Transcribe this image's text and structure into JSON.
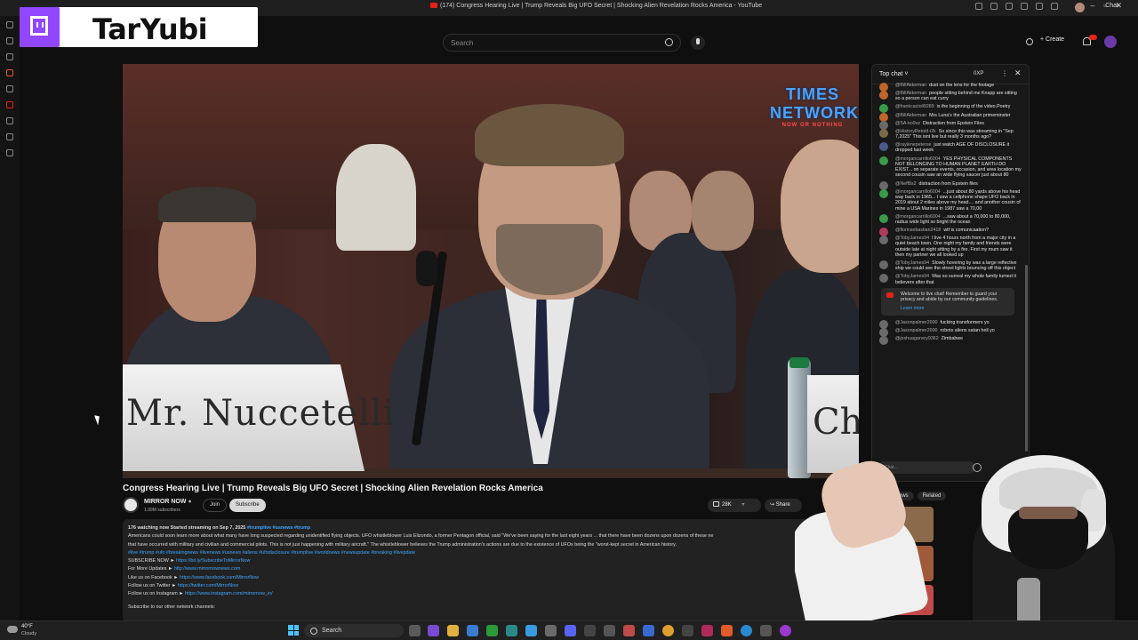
{
  "browser": {
    "tab_title": "(174) Congress Hearing Live | Trump Reveals Big UFO Secret | Shocking Alien Revelation Rocks America - YouTube",
    "chat_label": "Chat"
  },
  "overlay": {
    "channel_name": "TarYubi"
  },
  "header": {
    "search_placeholder": "Search",
    "create_label": "Create"
  },
  "video": {
    "watermark_line1": "TIMES NETWORK",
    "watermark_line2": "NOW OR NOTHING",
    "placard_left": "Mr. Nuccetelli",
    "placard_right": "Ch"
  },
  "info": {
    "title": "Congress Hearing Live | Trump Reveals Big UFO Secret | Shocking Alien Revelation Rocks America",
    "channel": "MIRROR NOW",
    "subscribers": "1.99M subscribers",
    "join_label": "Join",
    "subscribe_label": "Subscribe",
    "likes": "28K",
    "share_label": "Share"
  },
  "description": {
    "stats": "176 watching now  Started streaming on Sep 7, 2025",
    "stats_tags": "#trumplive #usnews #trump",
    "para1": "Americans could soon learn more about what many have long suspected regarding unidentified flying objects. UFO whistleblower Luis Elizondo, a former Pentagon official, said \"We've been saying for the last eight years ... that there have been dozens upon dozens of these ne",
    "para2": "that have occurred with military and civilian and commercial pilots. This is not just happening with military aircraft.\" The whistleblower believes the Trump administration's actions are due to the existence of UFOs being the \"worst-kept secret in American history.",
    "tags": "#live #trump #ufo #breakingnews #livenews #usnews #aliens #ufodisclosure #trumplive #worldnews #newsupdate #breaking #livepdate",
    "sub_now_label": "SUBSCRIBE NOW ►",
    "sub_now_link": "https://bit.ly/SubscribeToMirrorNow",
    "updates_label": "For More Updates ►",
    "updates_link": "http://www.mirrornownews.com",
    "fb_label": "Like us on Facebook ►",
    "fb_link": "https://www.facebook.com/MirrorNow",
    "tw_label": "Follow us on Twitter ►",
    "tw_link": "https://twitter.com/MirrorNow",
    "ig_label": "Follow us on Instagram ►",
    "ig_link": "https://www.instagram.com/mirrornow_in/",
    "other_channels": "Subscribe to our other network channels:"
  },
  "chat": {
    "header_label": "Top chat",
    "xp_label": "0XP",
    "messages": [
      {
        "author": "@BillAlderman",
        "text": "dust on the lens for the footage",
        "color": "#c0662c"
      },
      {
        "author": "@BillAlderman",
        "text": "people sitting behind me Knapp are sitting so a person can eat curry",
        "color": "#c0662c"
      },
      {
        "author": "@frankcacioli9289",
        "text": "is the beginning of the video.Poetry",
        "color": "#3a9a4a"
      },
      {
        "author": "@BillAlderman",
        "text": "Mrs Luna's the Australian primeminster",
        "color": "#c0662c"
      },
      {
        "author": "@SA-ko9vz",
        "text": "Distraction from Epstein Files",
        "color": "#6a6a6a"
      },
      {
        "author": "@HistoryRetold-i2k",
        "text": "So since this was streaming in \"Sep 7,2025\" This isnt live but really 3 months ago?",
        "color": "#7a6a4a"
      },
      {
        "author": "@raylenepeterse",
        "text": "just watch AGE OF DISCLOSURE it dropped last week",
        "color": "#4a5a8a"
      },
      {
        "author": "@morgancarrillo6004",
        "text": "YES PHYSICAL COMPONENTS NOT BELONGING TO HUMAN PLANET EARTH DO EXIST... on separate events, occasion, and area location my second cousin saw an wide flying saucer just about 80",
        "color": "#3a9a4a"
      },
      {
        "author": "@Neff8s2",
        "text": "distraction from Epstein files",
        "color": "#6a6a6a"
      },
      {
        "author": "@morgancarrillo6004",
        "text": "...just about 80 yards above his head way back in 1965... I saw a cellphone shape UFO back in 2019 about 2 miles above my head.... and another cousin of mine a USA Marines in 1987 saw a 70,00",
        "color": "#3a9a4a"
      },
      {
        "author": "@morgancarrillo6004",
        "text": "...saw about a 70,000 to 80,000, radius wide light so bright the ocean",
        "color": "#3a9a4a"
      },
      {
        "author": "@florinsebastian2418",
        "text": "wtf is comunicaation?",
        "color": "#b03a5a"
      },
      {
        "author": "@TobyJames94",
        "text": "I live 4 hours north from a major city in a quiet beach town. One night my family and friends were outside late at night sitting by a fire. First my mum saw it then my partner we all looked up",
        "color": "#6a6a6a"
      },
      {
        "author": "@TobyJames94",
        "text": "Slowly hovering by was a large reflective ship we could see the street lights bouncing off this object",
        "color": "#6a6a6a"
      },
      {
        "author": "@TobyJames94",
        "text": "Was so surreal my whole family turned it believers after that",
        "color": "#6a6a6a"
      }
    ],
    "notice_text": "Welcome to live chat! Remember to guard your privacy and abide by our community guidelines.",
    "notice_link": "Learn more",
    "messages_after": [
      {
        "author": "@Jasonpalmer2000",
        "text": "fucking transformers yo",
        "color": "#6a6a6a"
      },
      {
        "author": "@Jasonpalmer2000",
        "text": "robots aliens satan hell yo",
        "color": "#6a6a6a"
      },
      {
        "author": "@joshuagarvey9362",
        "text": "Zimbabwe",
        "color": "#6a6a6a"
      }
    ],
    "input_placeholder": "Chat..."
  },
  "recommendations": {
    "tab1": "Politics News",
    "tab2": "Related"
  },
  "taskbar": {
    "temperature": "40°F",
    "condition": "Cloudy",
    "search_label": "Search"
  }
}
